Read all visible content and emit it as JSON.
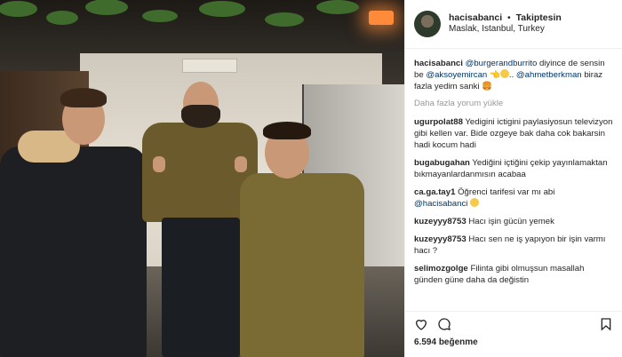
{
  "header": {
    "username": "hacisabanci",
    "follow_status": "Takiptesin",
    "location": "Maslak, Istanbul, Turkey"
  },
  "caption": {
    "user": "hacisabanci",
    "mention1": "@burgerandburrito",
    "text1": "diyince de sensin be",
    "mention2": "@aksoyemircan",
    "mention3": "@ahmetberkman",
    "text2": "biraz fazla yedim sanki"
  },
  "load_more": "Daha fazla yorum yükle",
  "comments": [
    {
      "user": "ugurpolat88",
      "text": "Yedigini ictigini paylasiyosun televizyon gibi kellen var. Bide ozgeye bak daha cok bakarsin hadi kocum hadi"
    },
    {
      "user": "bugabugahan",
      "text": "Yediğini içtiğini çekip yayınlamaktan bıkmayanlardanmısın acabaa"
    },
    {
      "user": "ca.ga.tay1",
      "text": "Öğrenci tarifesi var mı abi",
      "mention": "@hacisabanci"
    },
    {
      "user": "kuzeyyy8753",
      "text": "Hacı işin gücün yemek"
    },
    {
      "user": "kuzeyyy8753",
      "text": "Hacı sen ne iş yapıyon bir işin varmı hacı ?"
    },
    {
      "user": "selimozgolge",
      "text": "Filinta gibi olmuşsun masallah günden güne daha da değistin"
    }
  ],
  "likes": {
    "count": "6.594",
    "label": "beğenme"
  },
  "colors": {
    "link": "#003569",
    "muted": "#999999"
  }
}
